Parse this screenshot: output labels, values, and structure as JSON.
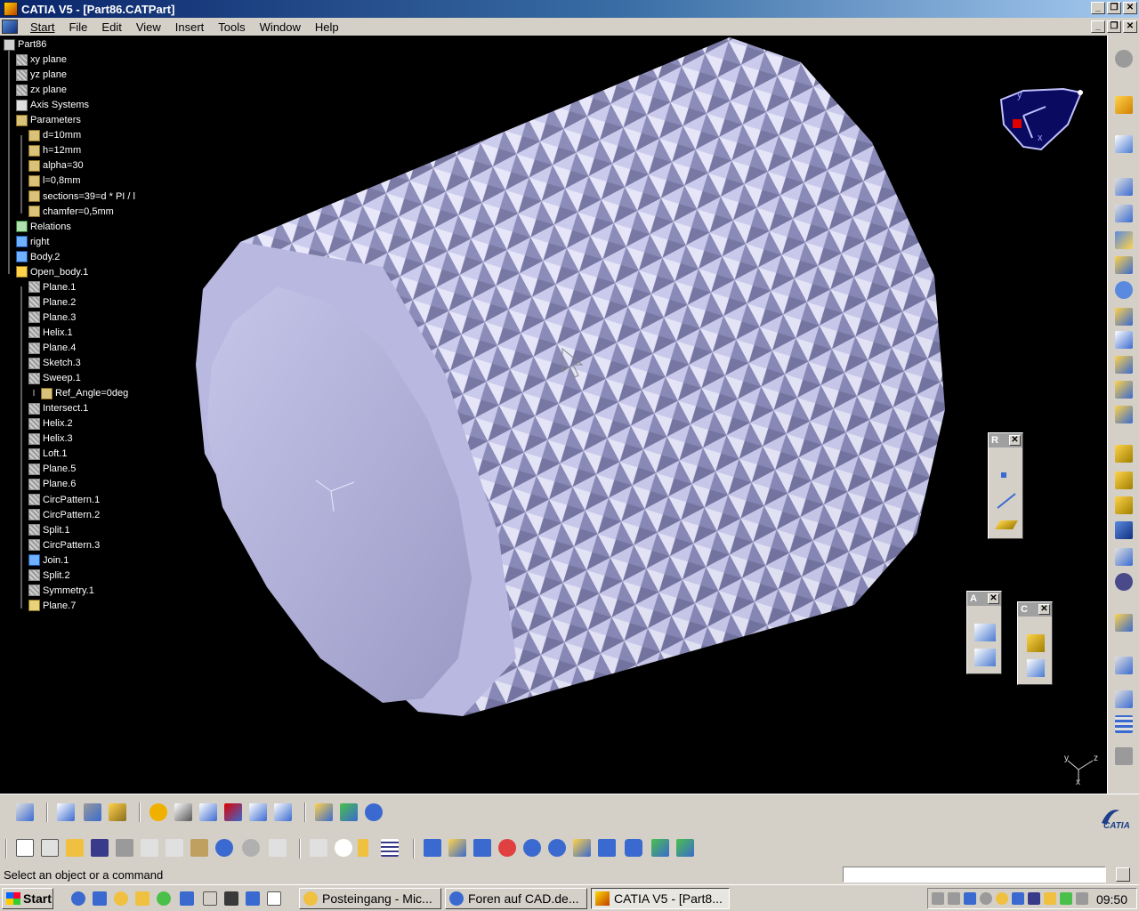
{
  "window": {
    "title": "CATIA V5 - [Part86.CATPart]"
  },
  "menu": [
    {
      "label": "Start"
    },
    {
      "label": "File"
    },
    {
      "label": "Edit"
    },
    {
      "label": "View"
    },
    {
      "label": "Insert"
    },
    {
      "label": "Tools"
    },
    {
      "label": "Window"
    },
    {
      "label": "Help"
    }
  ],
  "tree": [
    {
      "label": "Part86",
      "icon": "part-icon"
    },
    {
      "label": "xy plane",
      "icon": "plane-icon"
    },
    {
      "label": "yz plane",
      "icon": "plane-icon"
    },
    {
      "label": "zx plane",
      "icon": "plane-icon"
    },
    {
      "label": "Axis Systems",
      "icon": "axis-system-icon"
    },
    {
      "label": "Parameters",
      "icon": "parameters-icon"
    },
    {
      "label": "d=10mm",
      "icon": "parameter-icon"
    },
    {
      "label": "h=12mm",
      "icon": "parameter-icon"
    },
    {
      "label": "alpha=30",
      "icon": "parameter-icon"
    },
    {
      "label": "l=0,8mm",
      "icon": "parameter-icon"
    },
    {
      "label": "sections=39=d * PI / l",
      "icon": "parameter-icon"
    },
    {
      "label": "chamfer=0,5mm",
      "icon": "parameter-icon"
    },
    {
      "label": "Relations",
      "icon": "relations-icon"
    },
    {
      "label": "right",
      "icon": "body-icon"
    },
    {
      "label": "Body.2",
      "icon": "body-icon"
    },
    {
      "label": "Open_body.1",
      "icon": "open-body-icon"
    },
    {
      "label": "Plane.1",
      "icon": "plane-icon"
    },
    {
      "label": "Plane.2",
      "icon": "plane-icon"
    },
    {
      "label": "Plane.3",
      "icon": "plane-icon"
    },
    {
      "label": "Helix.1",
      "icon": "helix-icon"
    },
    {
      "label": "Plane.4",
      "icon": "plane-icon"
    },
    {
      "label": "Sketch.3",
      "icon": "sketch-icon"
    },
    {
      "label": "Sweep.1",
      "icon": "sweep-icon"
    },
    {
      "label": "Ref_Angle=0deg",
      "icon": "parameter-icon"
    },
    {
      "label": "Intersect.1",
      "icon": "intersect-icon"
    },
    {
      "label": "Helix.2",
      "icon": "helix-icon"
    },
    {
      "label": "Helix.3",
      "icon": "helix-icon"
    },
    {
      "label": "Loft.1",
      "icon": "loft-icon"
    },
    {
      "label": "Plane.5",
      "icon": "plane-icon"
    },
    {
      "label": "Plane.6",
      "icon": "plane-icon"
    },
    {
      "label": "CircPattern.1",
      "icon": "pattern-icon"
    },
    {
      "label": "CircPattern.2",
      "icon": "pattern-icon"
    },
    {
      "label": "Split.1",
      "icon": "split-icon"
    },
    {
      "label": "CircPattern.3",
      "icon": "pattern-icon"
    },
    {
      "label": "Join.1",
      "icon": "join-icon"
    },
    {
      "label": "Split.2",
      "icon": "split-icon"
    },
    {
      "label": "Symmetry.1",
      "icon": "symmetry-icon"
    },
    {
      "label": "Plane.7",
      "icon": "plane-icon"
    }
  ],
  "floating_toolbars": [
    {
      "title": "R"
    },
    {
      "title": "A"
    },
    {
      "title": "C"
    }
  ],
  "viewport": {
    "model_color": "#b4b4d8",
    "background": "#000000",
    "compass_labels": {
      "x": "x",
      "y": "y"
    },
    "axis_labels": {
      "x": "x",
      "y": "y",
      "z": "z"
    }
  },
  "brand": {
    "label": "CATIA"
  },
  "status": {
    "message": "Select an object or a command"
  },
  "taskbar": {
    "start_label": "Start",
    "tasks": [
      {
        "label": "Posteingang - Mic..."
      },
      {
        "label": "Foren auf CAD.de..."
      },
      {
        "label": "CATIA V5 - [Part8..."
      }
    ],
    "clock": "09:50"
  }
}
